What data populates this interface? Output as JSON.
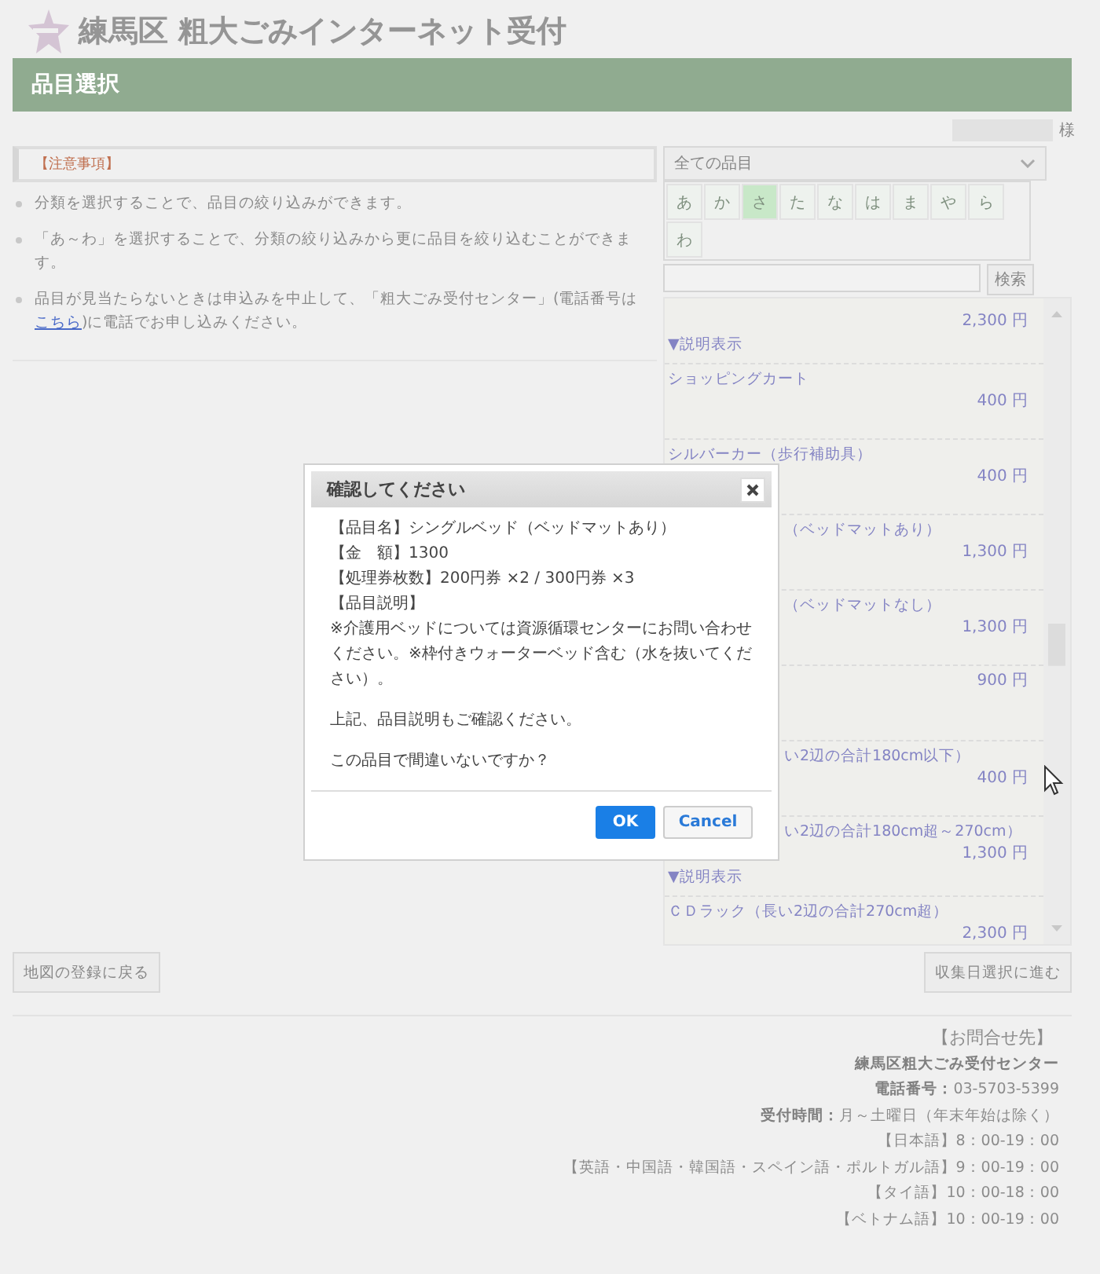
{
  "header": {
    "title": "練馬区 粗大ごみインターネット受付"
  },
  "page_title": "品目選択",
  "user": {
    "suffix": "様"
  },
  "notes": {
    "heading": "【注意事項】",
    "items": [
      {
        "text": "分類を選択することで、品目の絞り込みができます。"
      },
      {
        "text": "「あ～わ」を選択することで、分類の絞り込みから更に品目を絞り込むことができます。"
      },
      {
        "text": "品目が見当たらないときは申込みを中止して、「粗大ごみ受付センター」(電話番号は",
        "link": "こちら",
        "after": ")に電話でお申し込みください。"
      }
    ]
  },
  "category_select": {
    "value": "全ての品目"
  },
  "kana": [
    {
      "label": "あ",
      "selected": false
    },
    {
      "label": "か",
      "selected": false
    },
    {
      "label": "さ",
      "selected": true
    },
    {
      "label": "た",
      "selected": false
    },
    {
      "label": "な",
      "selected": false
    },
    {
      "label": "は",
      "selected": false
    },
    {
      "label": "ま",
      "selected": false
    },
    {
      "label": "や",
      "selected": false
    },
    {
      "label": "ら",
      "selected": false
    },
    {
      "label": "わ",
      "selected": false
    }
  ],
  "search": {
    "button": "検索"
  },
  "items": [
    {
      "kind": "top",
      "price": "2,300 円",
      "expand": "▼説明表示"
    },
    {
      "kind": "full",
      "name": "ショッピングカート",
      "price": "400 円"
    },
    {
      "kind": "full",
      "name": "シルバーカー（歩行補助具）",
      "price": "400 円"
    },
    {
      "kind": "covered",
      "name": "（ベッドマットあり）",
      "price": "1,300 円"
    },
    {
      "kind": "covered",
      "name": "（ベッドマットなし）",
      "price": "1,300 円"
    },
    {
      "kind": "covered",
      "price": "900 円"
    },
    {
      "kind": "covered",
      "name": "い2辺の合計180cm以下）",
      "price": "400 円"
    },
    {
      "kind": "covered",
      "name": "い2辺の合計180cm超～270cm）",
      "price": "1,300 円",
      "expand": "▼説明表示"
    },
    {
      "kind": "full",
      "name": "ＣＤラック（長い2辺の合計270cm超）",
      "price": "2,300 円"
    }
  ],
  "back_button": "地図の登録に戻る",
  "next_button": "収集日選択に進む",
  "contact": [
    "【お問合せ先】",
    "**練馬区粗大ごみ受付センター**",
    "**電話番号：**03-5703-5399",
    "**受付時間：**月～土曜日（年末年始は除く）",
    "【日本語】8：00-19：00",
    "【英語・中国語・韓国語・スペイン語・ポルトガル語】9：00-19：00",
    "【タイ語】10：00-18：00",
    "【ベトナム語】10：00-19：00"
  ],
  "dialog": {
    "title": "確認してください",
    "lines": [
      "【品目名】シングルベッド（ベッドマットあり）",
      "【金　額】1300",
      "【処理券枚数】200円券 ×2 / 300円券 ×3",
      "【品目説明】"
    ],
    "paragraphs": [
      "※介護用ベッドについては資源循環センターにお問い合わせください。※枠付きウォーターベッド含む（水を抜いてください）。",
      "上記、品目説明もご確認ください。",
      "この品目で間違いないですか？"
    ],
    "ok": "OK",
    "cancel": "Cancel"
  }
}
